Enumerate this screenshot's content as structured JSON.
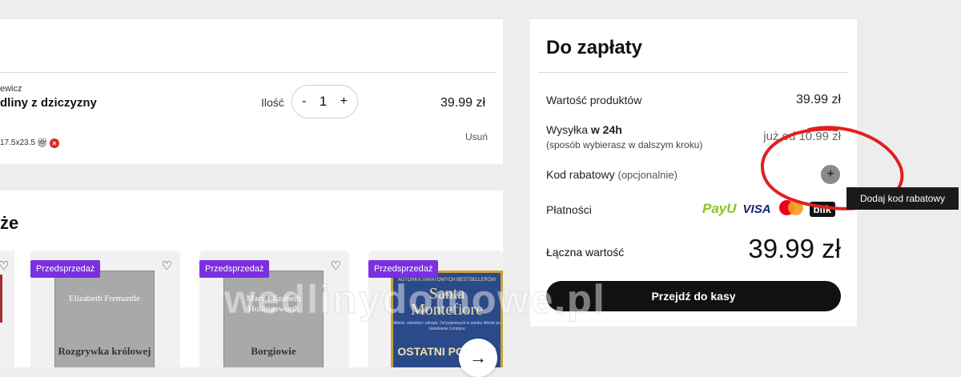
{
  "cart": {
    "author": "ewicz",
    "title": "dliny z dziczyzny",
    "dimensions": "17.5x23.5",
    "qty_label": "Ilość",
    "qty_minus": "-",
    "qty_value": "1",
    "qty_plus": "+",
    "price": "39.99 zł",
    "remove": "Usuń"
  },
  "recommendations": {
    "title": "że",
    "badge": "Przedsprzedaż",
    "books": [
      {
        "author": "Elizabeth Fremantle",
        "title": "Rozgrywka królowej"
      },
      {
        "author": "Mary Elizabeth Hollingsworth",
        "title": "Borgiowie"
      },
      {
        "tagline": "AUTORKA ŚWIATOWYCH BESTSELLERÓW",
        "author": "Santa Montefiore",
        "blurb": "Miłość, sekretny i zdrada. Od pojmanych w zamku Wenie po zwiedzanie Londynu",
        "title": "OSTATNI PODRÓŻ"
      }
    ],
    "next_arrow": "→"
  },
  "summary": {
    "title": "Do zapłaty",
    "products_label": "Wartość produktów",
    "products_value": "39.99 zł",
    "shipping_label": "Wysyłka",
    "shipping_bold": "w 24h",
    "shipping_sub": "(sposób wybierasz w dalszym kroku)",
    "shipping_value": "już od 10.99 zł",
    "discount_label": "Kod rabatowy",
    "discount_optional": "(opcjonalnie)",
    "discount_plus": "+",
    "payments_label": "Płatności",
    "payment_logos": [
      "PayU",
      "VISA",
      "mastercard",
      "blik"
    ],
    "total_label": "Łączna wartość",
    "total_value": "39.99 zł",
    "checkout_label": "Przejdź do kasy"
  },
  "tooltip": "Dodaj kod rabatowy",
  "watermark": "wedlinydomowe.pl",
  "annotation_color": "#e02020"
}
